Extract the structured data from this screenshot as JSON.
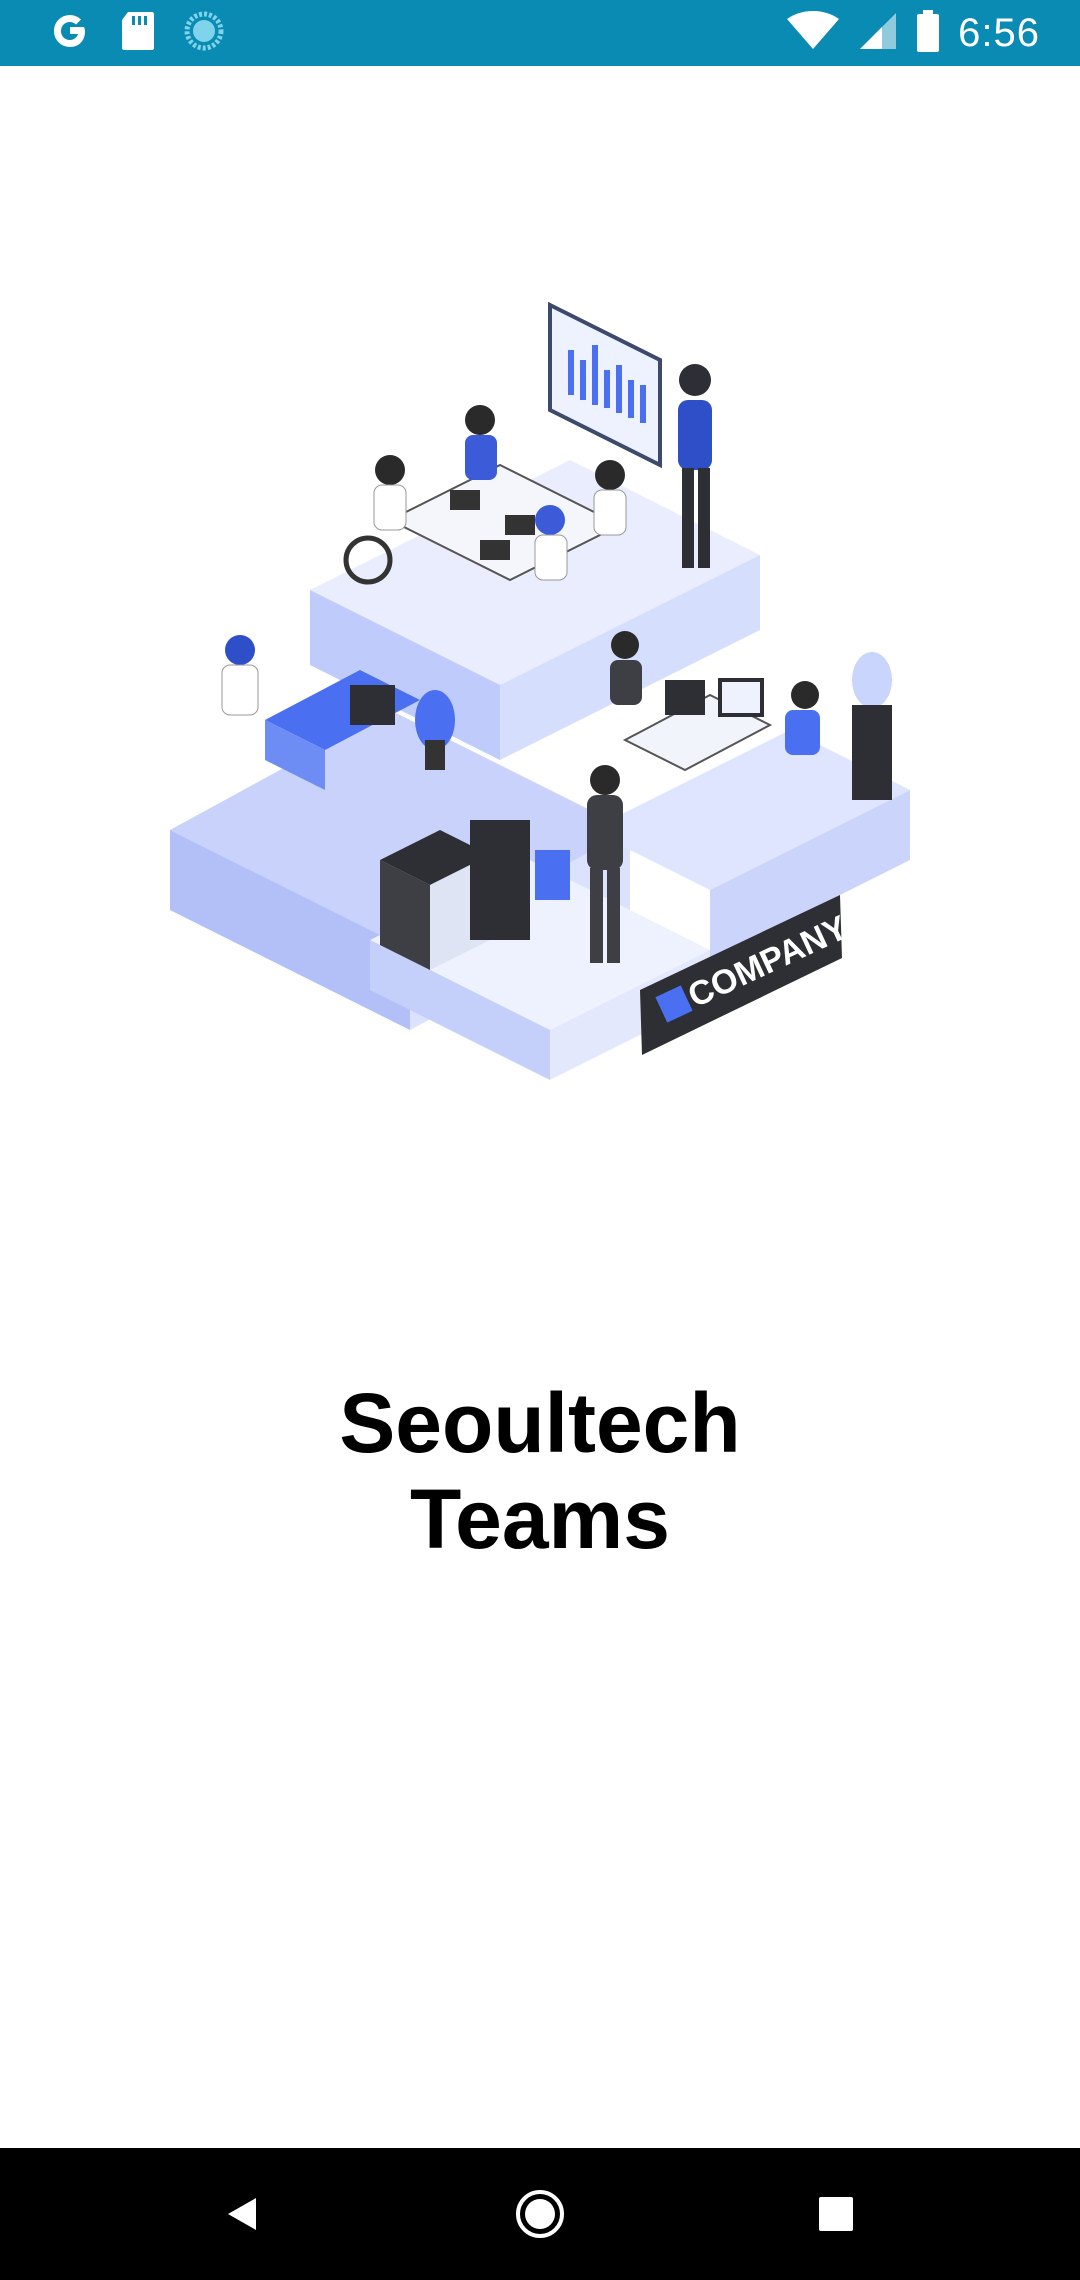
{
  "status_bar": {
    "time": "6:56",
    "left_icons": [
      "google-icon",
      "sd-card-icon",
      "sync-icon"
    ],
    "right_icons": [
      "wifi-icon",
      "signal-icon",
      "battery-icon"
    ],
    "background": "#0a8bb3"
  },
  "illustration": {
    "sign_text": "COMPANY",
    "accent": "#4a6ff0"
  },
  "app": {
    "title_line1": "Seoultech",
    "title_line2": "Teams"
  },
  "nav_bar": {
    "buttons": [
      "back-icon",
      "home-icon",
      "recents-icon"
    ]
  }
}
